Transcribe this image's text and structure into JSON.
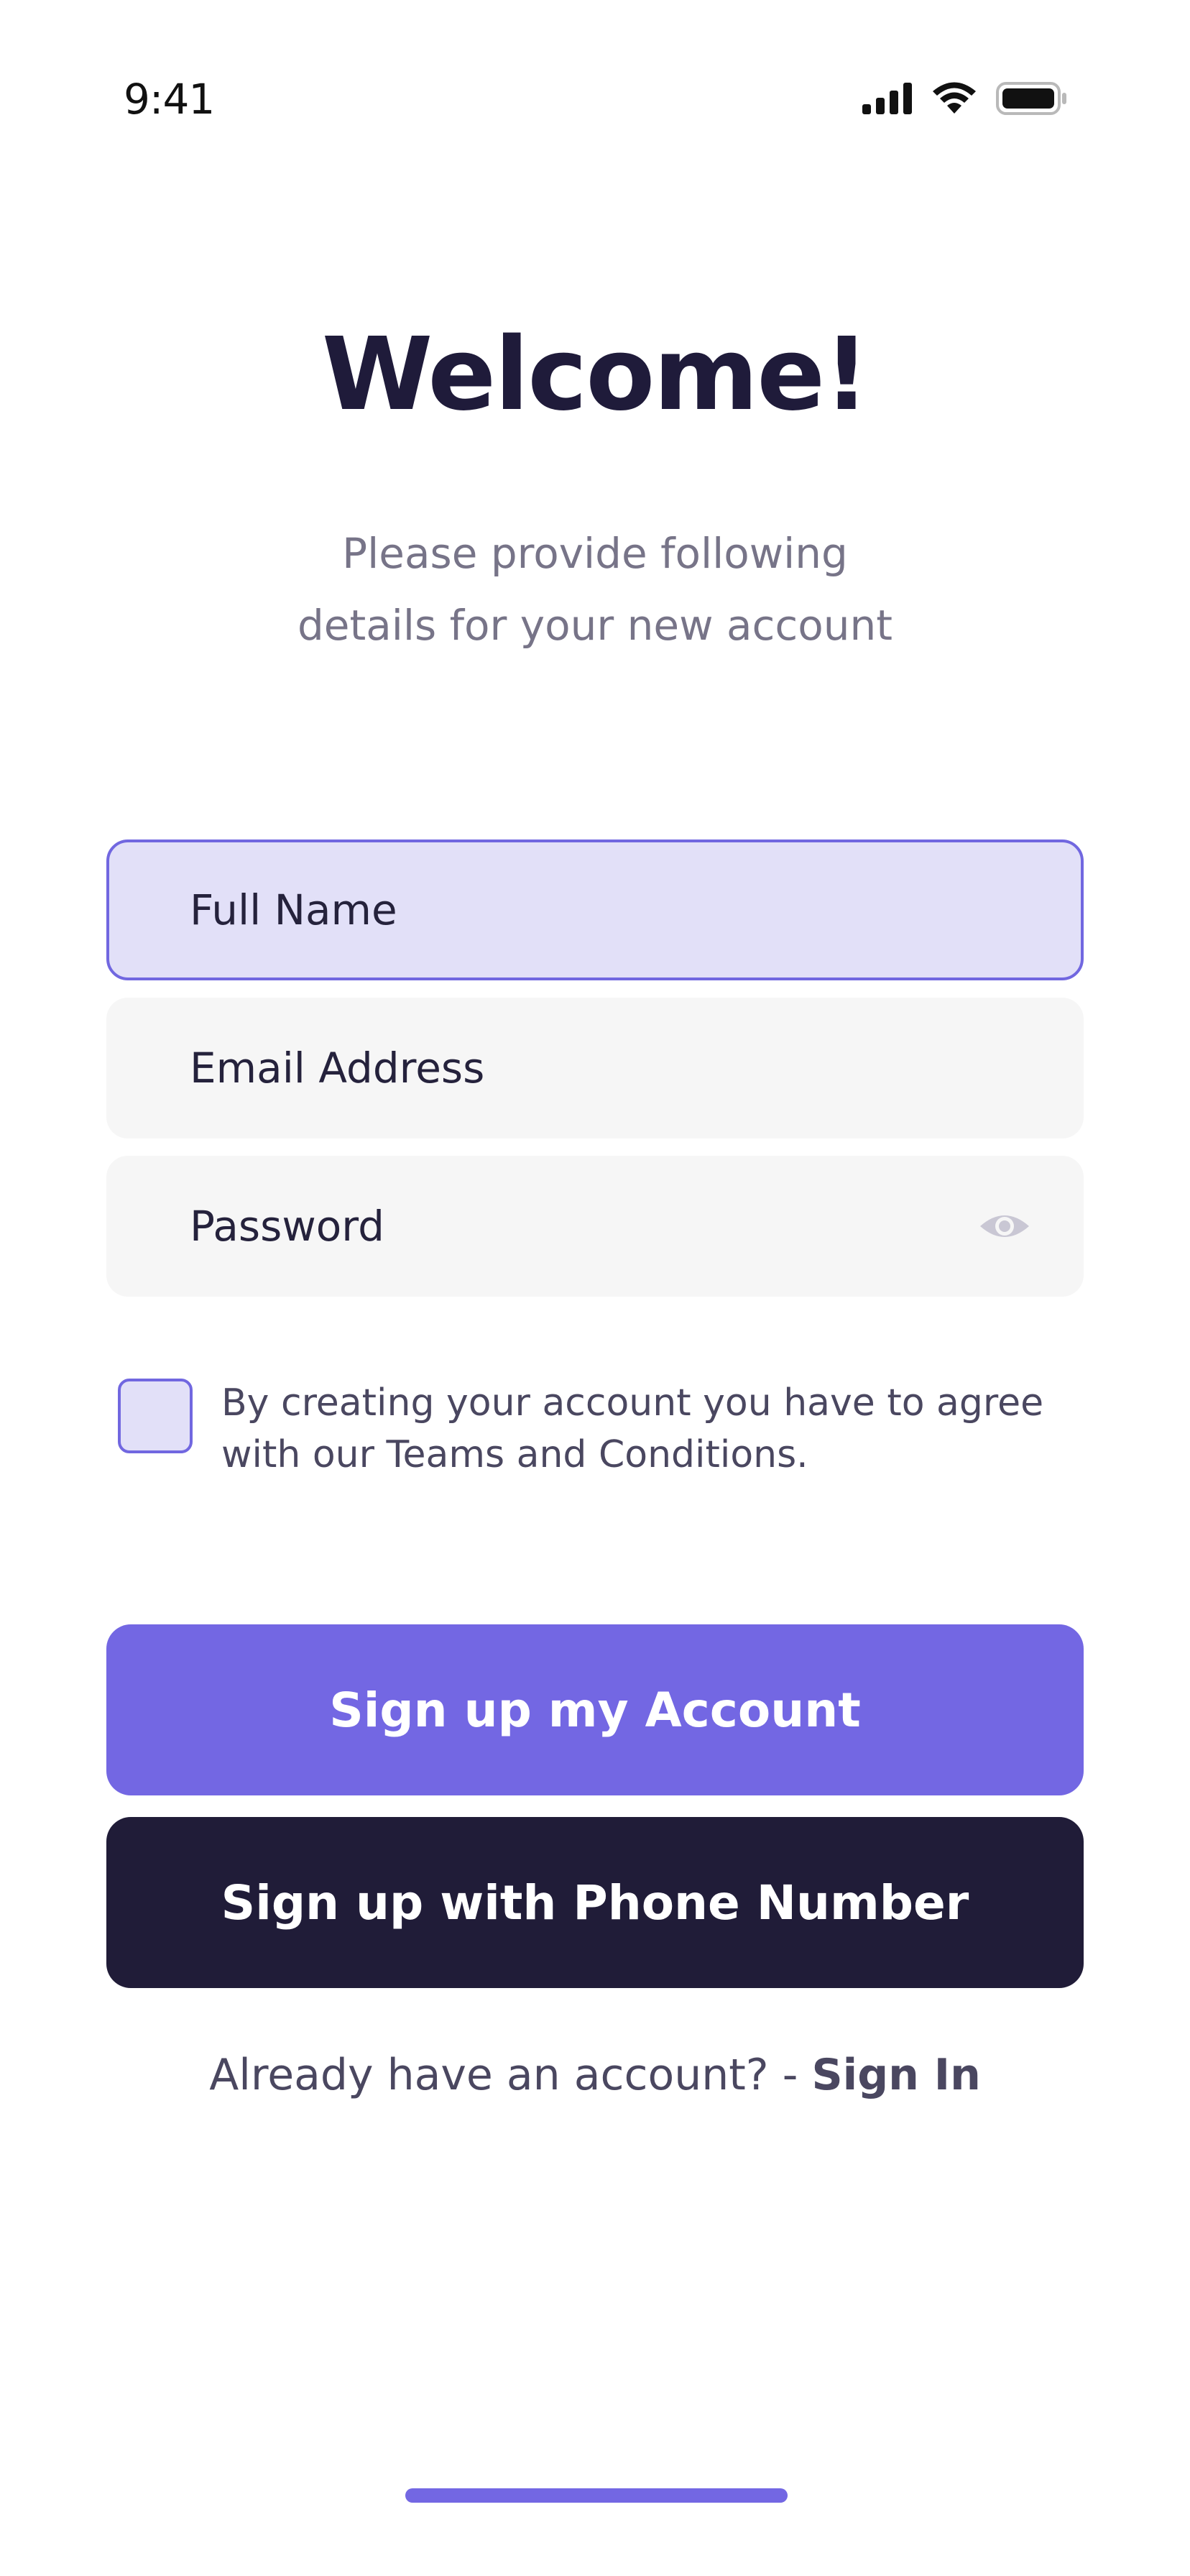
{
  "status_bar": {
    "time": "9:41",
    "icons": [
      "cellular-signal-icon",
      "wifi-icon",
      "battery-icon"
    ]
  },
  "header": {
    "title": "Welcome!",
    "subtitle_line1": "Please provide following",
    "subtitle_line2": "details for your new account"
  },
  "form": {
    "full_name_placeholder": "Full Name",
    "email_placeholder": "Email Address",
    "password_placeholder": "Password",
    "password_toggle_icon": "eye-icon",
    "terms_line1": "By creating your account you have to agree",
    "terms_line2": "with our Teams and Conditions.",
    "terms_checked": false
  },
  "actions": {
    "signup_label": "Sign up my Account",
    "phone_signup_label": "Sign up with Phone Number"
  },
  "footer": {
    "signin_prompt": "Already have an account? - ",
    "signin_link": "Sign In"
  },
  "colors": {
    "accent": "#7367e3",
    "dark": "#201c38",
    "active_field_bg": "#e2e0f8",
    "field_bg": "#f6f6f6"
  }
}
